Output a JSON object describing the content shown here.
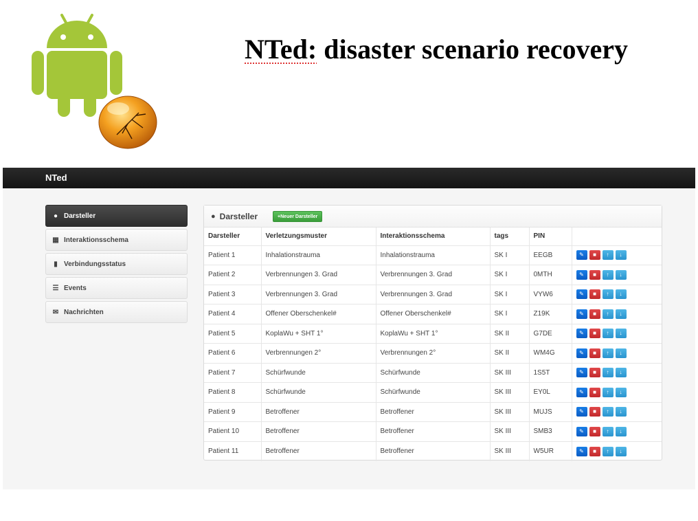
{
  "slide": {
    "title_word1": "NTed:",
    "title_rest": "disaster scenario recovery"
  },
  "app": {
    "brand": "NTed",
    "sidebar": [
      {
        "label": "Darsteller",
        "icon": "person-icon",
        "active": true
      },
      {
        "label": "Interaktionsschema",
        "icon": "grid-icon",
        "active": false
      },
      {
        "label": "Verbindungsstatus",
        "icon": "signal-icon",
        "active": false
      },
      {
        "label": "Events",
        "icon": "list-icon",
        "active": false
      },
      {
        "label": "Nachrichten",
        "icon": "envelope-icon",
        "active": false
      }
    ],
    "panel": {
      "title": "Darsteller",
      "new_button": "+Neuer Darsteller",
      "columns": [
        "Darsteller",
        "Verletzungsmuster",
        "Interaktionsschema",
        "tags",
        "PIN",
        ""
      ],
      "rows": [
        [
          "Patient 1",
          "Inhalationstrauma",
          "Inhalationstrauma",
          "SK I",
          "EEGB"
        ],
        [
          "Patient 2",
          "Verbrennungen 3. Grad",
          "Verbrennungen 3. Grad",
          "SK I",
          "0MTH"
        ],
        [
          "Patient 3",
          "Verbrennungen 3. Grad",
          "Verbrennungen 3. Grad",
          "SK I",
          "VYW6"
        ],
        [
          "Patient 4",
          "Offener Oberschenkel#",
          "Offener Oberschenkel#",
          "SK I",
          "Z19K"
        ],
        [
          "Patient 5",
          "KoplaWu + SHT 1°",
          "KoplaWu + SHT 1°",
          "SK II",
          "G7DE"
        ],
        [
          "Patient 6",
          "Verbrennungen 2°",
          "Verbrennungen 2°",
          "SK II",
          "WM4G"
        ],
        [
          "Patient 7",
          "Schürfwunde",
          "Schürfwunde",
          "SK III",
          "1S5T"
        ],
        [
          "Patient 8",
          "Schürfwunde",
          "Schürfwunde",
          "SK III",
          "EY0L"
        ],
        [
          "Patient 9",
          "Betroffener",
          "Betroffener",
          "SK III",
          "MUJS"
        ],
        [
          "Patient 10",
          "Betroffener",
          "Betroffener",
          "SK III",
          "SMB3"
        ],
        [
          "Patient 11",
          "Betroffener",
          "Betroffener",
          "SK III",
          "W5UR"
        ]
      ],
      "row_actions": [
        "edit-icon",
        "trash-icon",
        "arrow-up-icon",
        "arrow-down-icon"
      ]
    }
  },
  "colors": {
    "android_green": "#a4c639",
    "navbar": "#1c1c1c",
    "new_button": "#46a846",
    "edit": "#0f67d3",
    "delete": "#d33537",
    "move": "#3aa3da"
  }
}
